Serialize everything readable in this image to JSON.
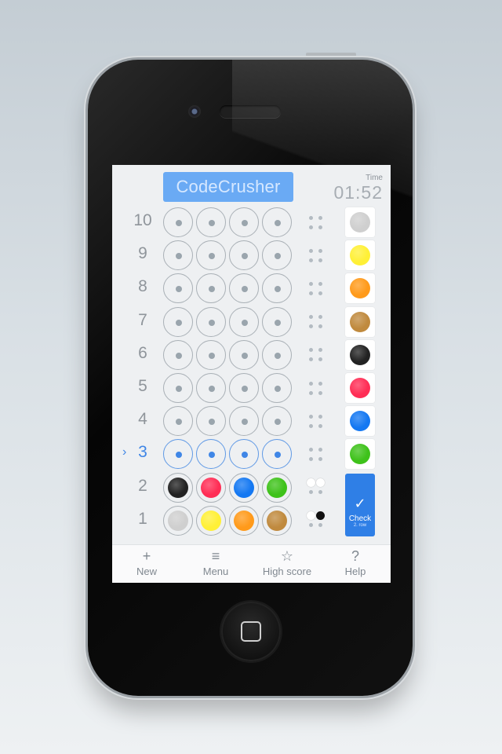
{
  "app": {
    "title": "CodeCrusher",
    "time_label": "Time",
    "time_value": "01:52"
  },
  "board": {
    "active_row": 3,
    "rows": [
      {
        "label": "10",
        "pegs": [
          null,
          null,
          null,
          null
        ],
        "feedback": [
          "empty",
          "empty",
          "empty",
          "empty"
        ]
      },
      {
        "label": "9",
        "pegs": [
          null,
          null,
          null,
          null
        ],
        "feedback": [
          "empty",
          "empty",
          "empty",
          "empty"
        ]
      },
      {
        "label": "8",
        "pegs": [
          null,
          null,
          null,
          null
        ],
        "feedback": [
          "empty",
          "empty",
          "empty",
          "empty"
        ]
      },
      {
        "label": "7",
        "pegs": [
          null,
          null,
          null,
          null
        ],
        "feedback": [
          "empty",
          "empty",
          "empty",
          "empty"
        ]
      },
      {
        "label": "6",
        "pegs": [
          null,
          null,
          null,
          null
        ],
        "feedback": [
          "empty",
          "empty",
          "empty",
          "empty"
        ]
      },
      {
        "label": "5",
        "pegs": [
          null,
          null,
          null,
          null
        ],
        "feedback": [
          "empty",
          "empty",
          "empty",
          "empty"
        ]
      },
      {
        "label": "4",
        "pegs": [
          null,
          null,
          null,
          null
        ],
        "feedback": [
          "empty",
          "empty",
          "empty",
          "empty"
        ]
      },
      {
        "label": "3",
        "pegs": [
          null,
          null,
          null,
          null
        ],
        "feedback": [
          "empty",
          "empty",
          "empty",
          "empty"
        ]
      },
      {
        "label": "2",
        "pegs": [
          "black",
          "red",
          "blue",
          "green"
        ],
        "feedback": [
          "white",
          "white",
          "empty",
          "empty"
        ]
      },
      {
        "label": "1",
        "pegs": [
          "silver",
          "yellow",
          "orange",
          "brown"
        ],
        "feedback": [
          "white",
          "black",
          "empty",
          "empty"
        ]
      }
    ]
  },
  "palette": [
    "silver",
    "yellow",
    "orange",
    "brown",
    "black",
    "red",
    "blue",
    "green"
  ],
  "colors": {
    "silver": "#cfcfcf",
    "yellow": "#fff036",
    "orange": "#ff9a1a",
    "brown": "#c08a3e",
    "black": "#222222",
    "red": "#ff2d55",
    "blue": "#1478f2",
    "green": "#3ec21a",
    "accent": "#2f7fe6"
  },
  "check_button": {
    "icon": "checkmark-icon",
    "label": "Check",
    "sublabel": "2. row"
  },
  "tabbar": [
    {
      "icon": "plus-icon",
      "glyph": "+",
      "label": "New"
    },
    {
      "icon": "menu-icon",
      "glyph": "≡",
      "label": "Menu"
    },
    {
      "icon": "star-icon",
      "glyph": "☆",
      "label": "High score"
    },
    {
      "icon": "help-icon",
      "glyph": "?",
      "label": "Help"
    }
  ]
}
